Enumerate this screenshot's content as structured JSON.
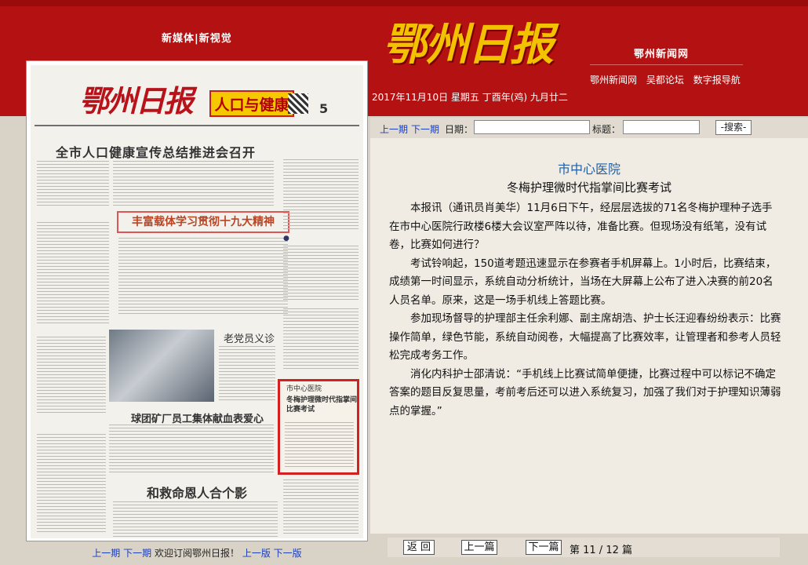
{
  "header": {
    "slogan": "新媒体|新视觉",
    "logo_text": "鄂州日报",
    "site_name": "鄂州新闻网",
    "links": [
      "鄂州新闻网",
      "吴都论坛",
      "数字报导航"
    ],
    "date": "2017年11月10日 星期五 丁酉年(鸡) 九月廿二"
  },
  "paper": {
    "logo": "鄂州日报",
    "section_box": "人口与健康",
    "page_number": "5",
    "headline_main": "全市人口健康宣传总结推进会召开",
    "headline_box": "丰富载体学习贯彻十九大精神",
    "headline_doctor": "老党员义诊",
    "headline_blood": "球团矿厂员工集体献血表爱心",
    "headline_bottom": "和救命恩人合个影",
    "highlight_section": "市中心医院",
    "highlight_title": "冬梅护理微时代指掌间比赛考试",
    "footer_prev": "上一期",
    "footer_next": "下一期",
    "footer_text": "欢迎订阅鄂州日报！",
    "footer_prev_page": "上一版",
    "footer_next_page": "下一版"
  },
  "search": {
    "prev": "上一期",
    "next": "下一期",
    "date_label": "日期：",
    "title_label": "标题：",
    "button": "-搜索-"
  },
  "article": {
    "section": "市中心医院",
    "title": "冬梅护理微时代指掌间比赛考试",
    "paragraphs": [
      "本报讯（通讯员肖美华）11月6日下午，经层层选拔的71名冬梅护理种子选手在市中心医院行政楼6楼大会议室严阵以待，准备比赛。但现场没有纸笔，没有试卷，比赛如何进行？",
      "考试铃响起，150道考题迅速显示在参赛者手机屏幕上。1小时后，比赛结束，成绩第一时间显示，系统自动分析统计，当场在大屏幕上公布了进入决赛的前20名人员名单。原来，这是一场手机线上答题比赛。",
      "参加现场督导的护理部主任余利娜、副主席胡浩、护士长汪迎春纷纷表示：比赛操作简单，绿色节能，系统自动阅卷，大幅提高了比赛效率，让管理者和参考人员轻松完成考务工作。",
      "消化内科护士邵清说：“手机线上比赛试简单便捷，比赛过程中可以标记不确定答案的题目反复思量，考前考后还可以进入系统复习，加强了我们对于护理知识薄弱点的掌握。”"
    ]
  },
  "nav": {
    "back": "返 回",
    "prev": "上一篇",
    "next": "下一篇",
    "page_info": "第 11 / 12 篇"
  }
}
